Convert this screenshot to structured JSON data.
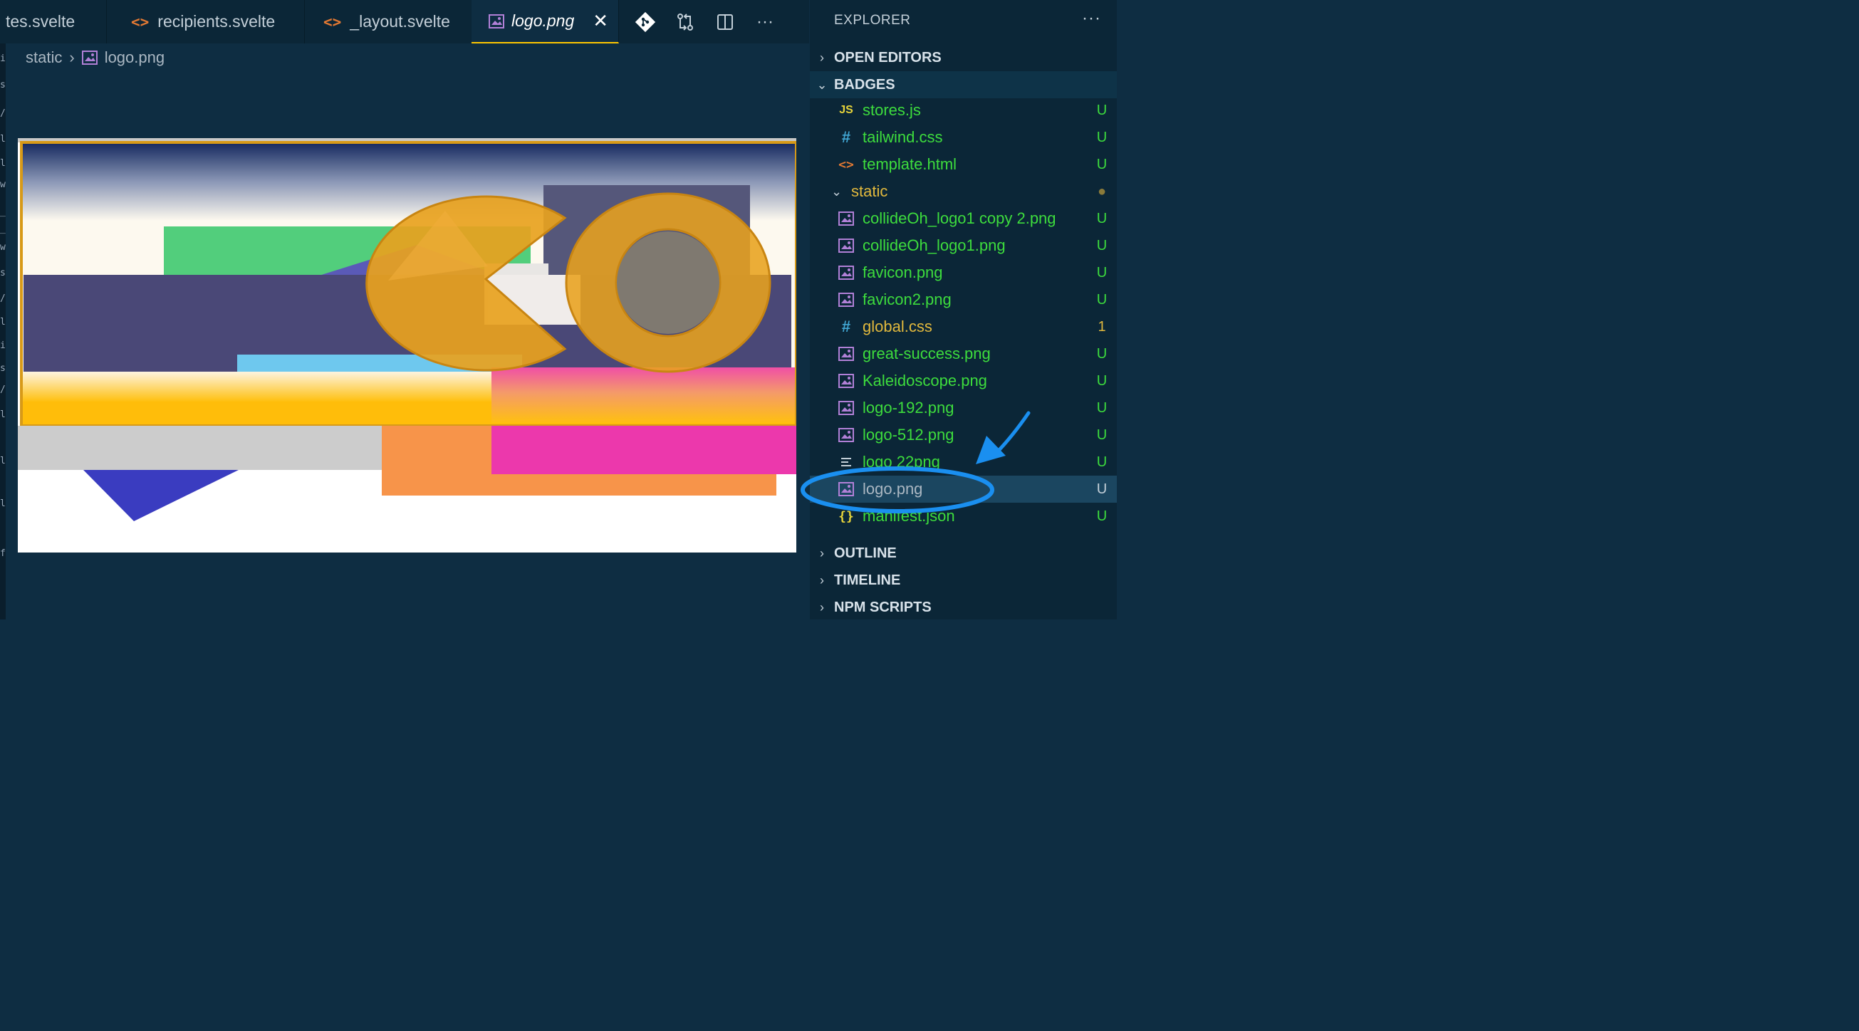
{
  "left_sliver_chars": [
    "/",
    "l",
    "i",
    "s",
    "/",
    "l",
    "l",
    "w",
    "_",
    "_",
    "w",
    "s",
    "/",
    "l",
    "i",
    "s",
    "/",
    "l",
    "l",
    "l",
    "f"
  ],
  "tabs": [
    {
      "label": "tes.svelte",
      "icon": "",
      "active": false
    },
    {
      "label": "recipients.svelte",
      "icon": "<>",
      "active": false
    },
    {
      "label": "_layout.svelte",
      "icon": "<>",
      "active": false
    },
    {
      "label": "logo.png",
      "icon": "image-icon",
      "active": true,
      "close": "✕"
    }
  ],
  "tab_actions": [
    "git-icon",
    "compare-icon",
    "split-editor-icon",
    "more-icon"
  ],
  "tab_actions_glyphs": {
    "more": "···"
  },
  "breadcrumb": {
    "folder": "static",
    "separator": "›",
    "file": "logo.png"
  },
  "explorer": {
    "title": "EXPLORER",
    "more": "···",
    "sections": {
      "open_editors": "OPEN EDITORS",
      "badges": "BADGES",
      "outline": "OUTLINE",
      "timeline": "TIMELINE",
      "npm_scripts": "NPM SCRIPTS"
    },
    "files_top": [
      {
        "name": "stores.js",
        "icon": "JS",
        "status": "U"
      },
      {
        "name": "tailwind.css",
        "icon": "#",
        "status": "U"
      },
      {
        "name": "template.html",
        "icon": "<>",
        "status": "U"
      }
    ],
    "folder": {
      "name": "static",
      "status": "●"
    },
    "static_files": [
      {
        "name": "collideOh_logo1 copy 2.png",
        "icon": "image-icon",
        "status": "U",
        "color": "#3ddc3d"
      },
      {
        "name": "collideOh_logo1.png",
        "icon": "image-icon",
        "status": "U",
        "color": "#3ddc3d"
      },
      {
        "name": "favicon.png",
        "icon": "image-icon",
        "status": "U",
        "color": "#3ddc3d"
      },
      {
        "name": "favicon2.png",
        "icon": "image-icon",
        "status": "U",
        "color": "#3ddc3d"
      },
      {
        "name": "global.css",
        "icon": "#",
        "status": "1",
        "color": "#e2b93d"
      },
      {
        "name": "great-success.png",
        "icon": "image-icon",
        "status": "U",
        "color": "#3ddc3d"
      },
      {
        "name": "Kaleidoscope.png",
        "icon": "image-icon",
        "status": "U",
        "color": "#3ddc3d"
      },
      {
        "name": "logo-192.png",
        "icon": "image-icon",
        "status": "U",
        "color": "#3ddc3d"
      },
      {
        "name": "logo-512.png",
        "icon": "image-icon",
        "status": "U",
        "color": "#3ddc3d"
      },
      {
        "name": "logo 22png",
        "icon": "lines-icon",
        "status": "U",
        "color": "#3ddc3d"
      },
      {
        "name": "logo.png",
        "icon": "image-icon",
        "status": "U",
        "color": "#aab7c2",
        "selected": true
      },
      {
        "name": "manifest.json",
        "icon": "{}",
        "status": "U",
        "color": "#3ddc3d"
      }
    ]
  },
  "colors": {
    "editor_bg": "#0e2d42",
    "sidebar_bg": "#0b2637",
    "untracked_green": "#3ddc3d",
    "modified_yellow": "#e2b93d",
    "accent_tab": "#ffc600",
    "annotation_blue": "#1a8ff0"
  }
}
